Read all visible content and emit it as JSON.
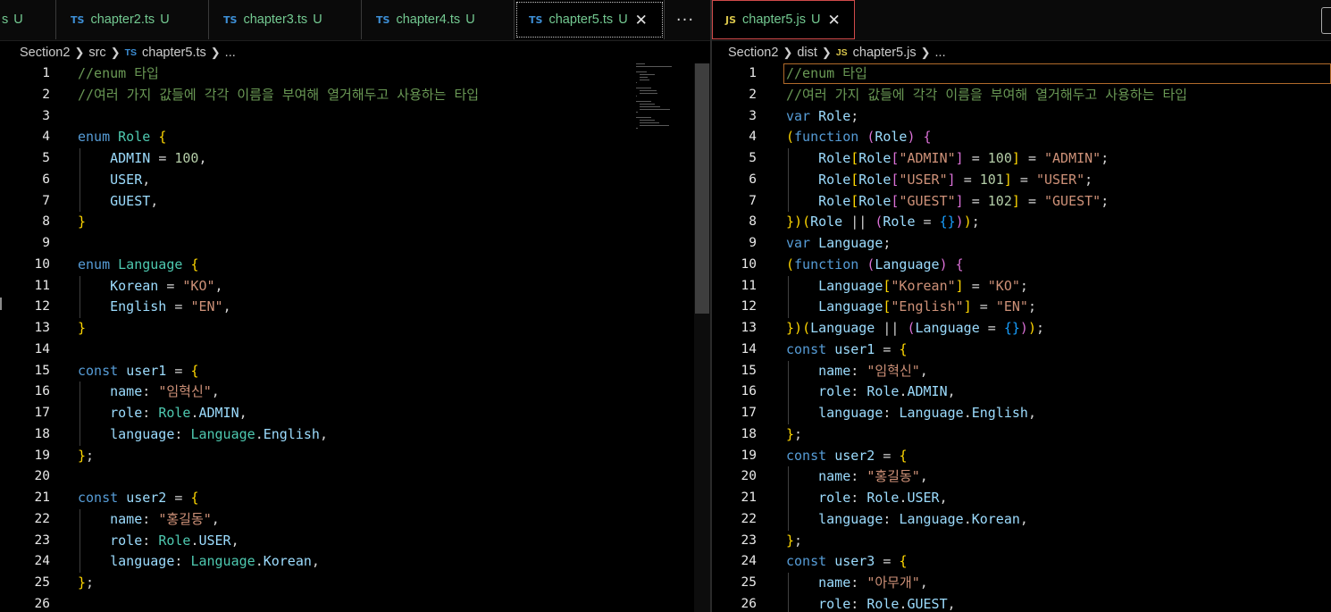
{
  "left_pane": {
    "tabs": [
      {
        "badge": "",
        "name": "s",
        "status": "U",
        "active": false
      },
      {
        "badge": "TS",
        "name": "chapter2.ts",
        "status": "U",
        "active": false
      },
      {
        "badge": "TS",
        "name": "chapter3.ts",
        "status": "U",
        "active": false
      },
      {
        "badge": "TS",
        "name": "chapter4.ts",
        "status": "U",
        "active": false
      },
      {
        "badge": "TS",
        "name": "chapter5.ts",
        "status": "U",
        "active": true
      }
    ],
    "more_label": "···",
    "breadcrumb": {
      "root": "Section2",
      "folder": "src",
      "badge": "TS",
      "file": "chapter5.ts",
      "ellipsis": "..."
    }
  },
  "right_pane": {
    "tabs": [
      {
        "badge": "JS",
        "name": "chapter5.js",
        "status": "U",
        "active": true
      }
    ],
    "breadcrumb": {
      "root": "Section2",
      "folder": "dist",
      "badge": "JS",
      "file": "chapter5.js",
      "ellipsis": "..."
    }
  },
  "close_glyph": "✕",
  "colors": {
    "comment": "#6a9955",
    "keyword": "#569cd6",
    "type": "#4ec9b0",
    "variable": "#9cdcfe",
    "string": "#ce9178",
    "number": "#b5cea8",
    "bracket1": "#ffd700",
    "bracket2": "#da70d6",
    "bracket3": "#179fff",
    "ts_badge": "#3d8fd6",
    "js_badge": "#d8c44a",
    "untracked": "#73c991"
  },
  "left_code": [
    "//enum 타입",
    "//여러 가지 값들에 각각 이름을 부여해 열거해두고 사용하는 타입",
    "",
    "enum Role {",
    "    ADMIN = 100,",
    "    USER,",
    "    GUEST,",
    "}",
    "",
    "enum Language {",
    "    Korean = \"KO\",",
    "    English = \"EN\",",
    "}",
    "",
    "const user1 = {",
    "    name: \"임혁신\",",
    "    role: Role.ADMIN,",
    "    language: Language.English,",
    "};",
    "",
    "const user2 = {",
    "    name: \"홍길동\",",
    "    role: Role.USER,",
    "    language: Language.Korean,",
    "};",
    ""
  ],
  "right_code": [
    "//enum 타입",
    "//여러 가지 값들에 각각 이름을 부여해 열거해두고 사용하는 타입",
    "var Role;",
    "(function (Role) {",
    "    Role[Role[\"ADMIN\"] = 100] = \"ADMIN\";",
    "    Role[Role[\"USER\"] = 101] = \"USER\";",
    "    Role[Role[\"GUEST\"] = 102] = \"GUEST\";",
    "})(Role || (Role = {}));",
    "var Language;",
    "(function (Language) {",
    "    Language[\"Korean\"] = \"KO\";",
    "    Language[\"English\"] = \"EN\";",
    "})(Language || (Language = {}));",
    "const user1 = {",
    "    name: \"임혁신\",",
    "    role: Role.ADMIN,",
    "    language: Language.English,",
    "};",
    "const user2 = {",
    "    name: \"홍길동\",",
    "    role: Role.USER,",
    "    language: Language.Korean,",
    "};",
    "const user3 = {",
    "    name: \"아무개\",",
    "    role: Role.GUEST,"
  ]
}
